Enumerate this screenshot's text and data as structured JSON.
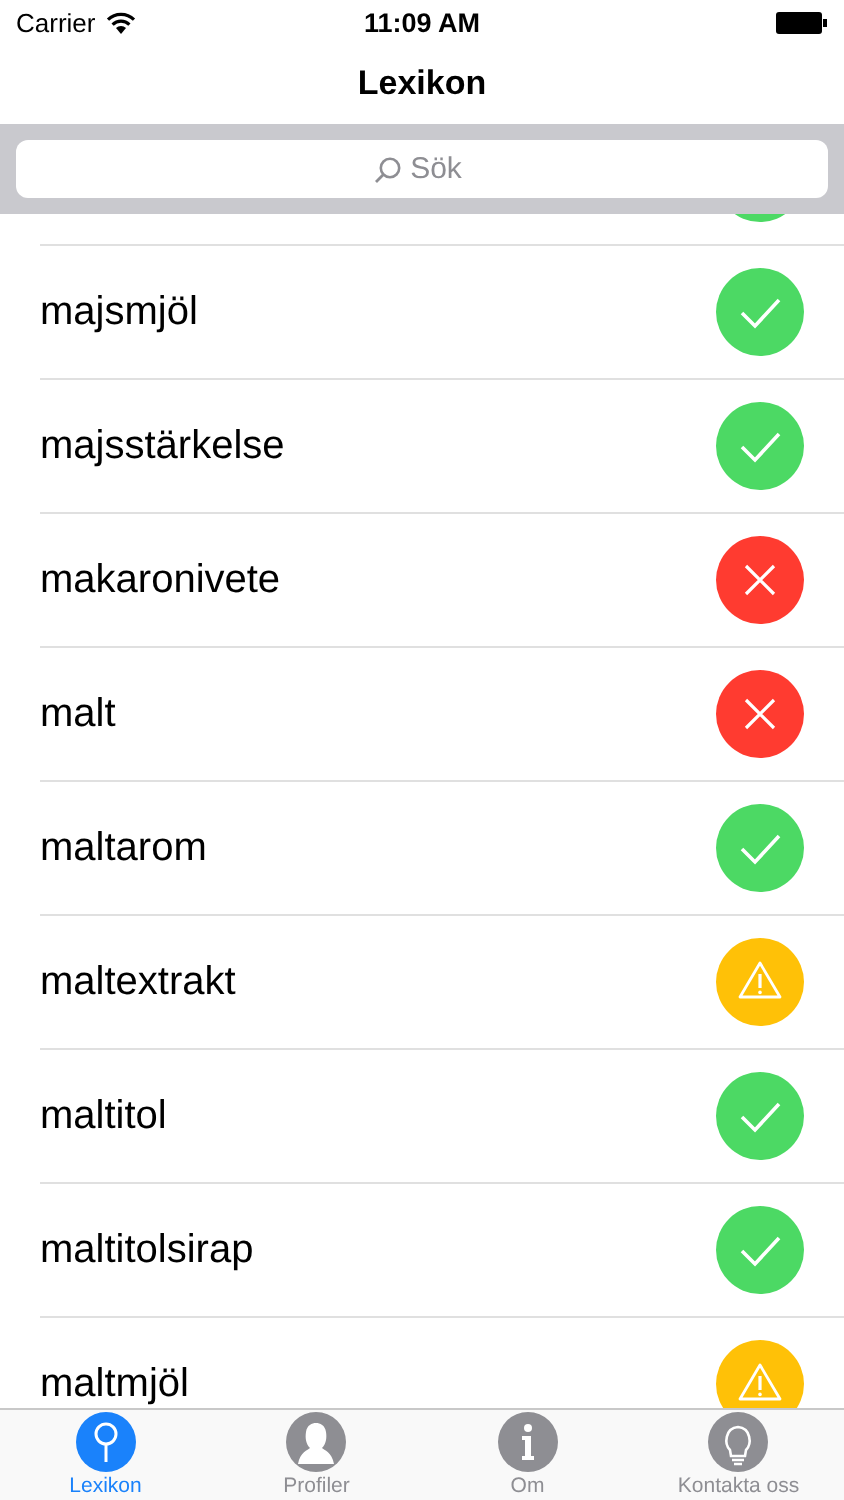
{
  "status_bar": {
    "carrier": "Carrier",
    "time": "11:09 AM"
  },
  "nav": {
    "title": "Lexikon"
  },
  "search": {
    "placeholder": "Sök"
  },
  "rows": [
    {
      "kind": "ok"
    },
    {
      "name": "majsmjöl",
      "kind": "ok"
    },
    {
      "name": "majsstärkelse",
      "kind": "ok"
    },
    {
      "name": "makaronivete",
      "kind": "no"
    },
    {
      "name": "malt",
      "kind": "no"
    },
    {
      "name": "maltarom",
      "kind": "ok"
    },
    {
      "name": "maltextrakt",
      "kind": "warn"
    },
    {
      "name": "maltitol",
      "kind": "ok"
    },
    {
      "name": "maltitolsirap",
      "kind": "ok"
    },
    {
      "name": "maltmjöl",
      "kind": "warn"
    }
  ],
  "tabs": [
    {
      "label": "Lexikon",
      "kind": "pin",
      "selected": true
    },
    {
      "label": "Profiler",
      "kind": "person",
      "selected": false
    },
    {
      "label": "Om",
      "kind": "info",
      "selected": false
    },
    {
      "label": "Kontakta oss",
      "kind": "bulb",
      "selected": false
    }
  ]
}
